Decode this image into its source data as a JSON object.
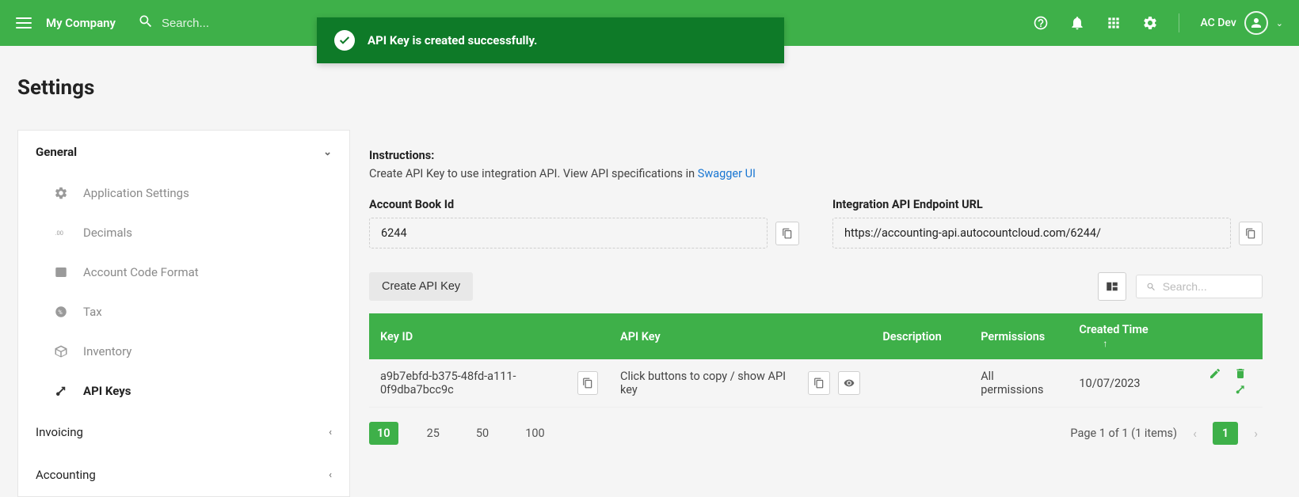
{
  "colors": {
    "primary": "#3eb049",
    "toast": "#0e7a28"
  },
  "header": {
    "company": "My Company",
    "search_placeholder": "Search...",
    "user": "AC Dev"
  },
  "toast": {
    "message": "API Key is created successfully."
  },
  "page": {
    "title": "Settings"
  },
  "sidebar": {
    "sections": [
      {
        "label": "General",
        "expanded": true
      },
      {
        "label": "Invoicing",
        "expanded": false
      },
      {
        "label": "Accounting",
        "expanded": false
      }
    ],
    "general_items": [
      {
        "label": "Application Settings",
        "icon": "gear"
      },
      {
        "label": "Decimals",
        "icon": "decimals"
      },
      {
        "label": "Account Code Format",
        "icon": "code"
      },
      {
        "label": "Tax",
        "icon": "percent"
      },
      {
        "label": "Inventory",
        "icon": "box"
      },
      {
        "label": "API Keys",
        "icon": "key",
        "active": true
      }
    ]
  },
  "main": {
    "instructions_label": "Instructions:",
    "instructions_text": "Create API Key to use integration API. View API specifications in ",
    "instructions_link": "Swagger UI",
    "account_book_label": "Account Book Id",
    "account_book_id": "6244",
    "endpoint_label": "Integration API Endpoint URL",
    "endpoint_url": "https://accounting-api.autocountcloud.com/6244/",
    "create_btn": "Create API Key",
    "table_search_placeholder": "Search...",
    "columns": {
      "key_id": "Key ID",
      "api_key": "API Key",
      "description": "Description",
      "permissions": "Permissions",
      "created": "Created Time"
    },
    "rows": [
      {
        "key_id": "a9b7ebfd-b375-48fd-a111-0f9dba7bcc9c",
        "api_key_hint": "Click buttons to copy / show API key",
        "description": "",
        "permissions": "All permissions",
        "created": "10/07/2023"
      }
    ],
    "page_sizes": [
      "10",
      "25",
      "50",
      "100"
    ],
    "page_size_active": "10",
    "pager_text": "Page 1 of 1 (1 items)",
    "pager_current": "1"
  }
}
